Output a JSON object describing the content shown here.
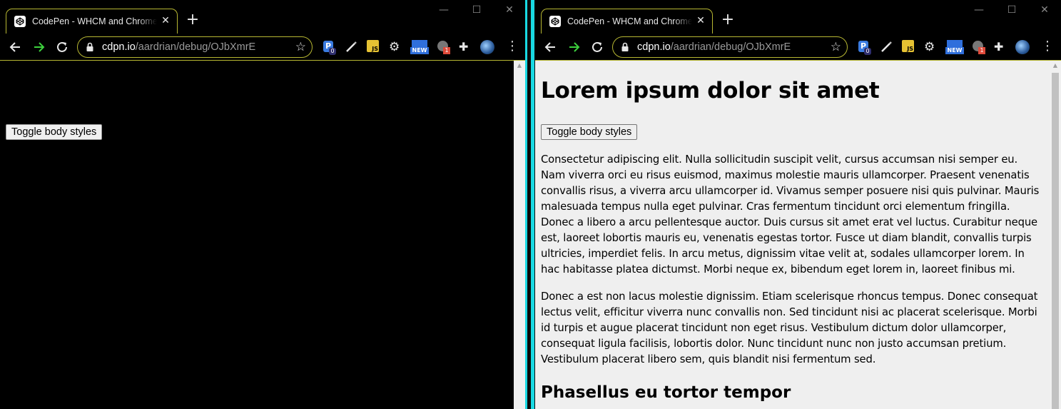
{
  "browser": {
    "tab_title": "CodePen - WHCM and Chrome Extension",
    "url_host": "cdpn.io",
    "url_path": "/aardrian/debug/OJbXmrE",
    "new_tab_label": "+",
    "tab_close": "✕",
    "window_controls": {
      "minimize": "—",
      "maximize": "☐",
      "close": "✕"
    },
    "extensions": [
      {
        "name": "p-extension-icon",
        "badge": "0"
      },
      {
        "name": "pen-extension-icon",
        "badge": ""
      },
      {
        "name": "js-extension-icon",
        "badge": ""
      },
      {
        "name": "gear-extension-icon",
        "badge": ""
      },
      {
        "name": "new-extension-icon",
        "badge": "NEW"
      },
      {
        "name": "grey-extension-icon",
        "badge": "1"
      },
      {
        "name": "puzzle-extension-icon",
        "badge": ""
      },
      {
        "name": "globe-profile-icon",
        "badge": ""
      }
    ]
  },
  "page": {
    "heading": "Lorem ipsum dolor sit amet",
    "toggle_button": "Toggle body styles",
    "paragraphs": [
      "Consectetur adipiscing elit. Nulla sollicitudin suscipit velit, cursus accumsan nisi semper eu. Nam viverra orci eu risus euismod, maximus molestie mauris ullamcorper. Praesent venenatis convallis risus, a viverra arcu ullamcorper id. Vivamus semper posuere nisi quis pulvinar. Mauris malesuada tempus nulla eget pulvinar. Cras fermentum tincidunt orci elementum fringilla. Donec a libero a arcu pellentesque auctor. Duis cursus sit amet erat vel luctus. Curabitur neque est, laoreet lobortis mauris eu, venenatis egestas tortor. Fusce ut diam blandit, convallis turpis ultricies, imperdiet felis. In arcu metus, dignissim vitae velit at, sodales ullamcorper lorem. In hac habitasse platea dictumst. Morbi neque ex, bibendum eget lorem in, laoreet finibus mi.",
      "Donec a est non lacus molestie dignissim. Etiam scelerisque rhoncus tempus. Donec consequat lectus velit, efficitur viverra nunc convallis non. Sed tincidunt nisi ac placerat scelerisque. Morbi id turpis et augue placerat tincidunt non eget risus. Vestibulum dictum dolor ullamcorper, consequat ligula facilisis, lobortis dolor. Nunc tincidunt nunc non justo accumsan pretium. Vestibulum placerat libero sem, quis blandit nisi fermentum sed."
    ],
    "subheading": "Phasellus eu tortor tempor"
  },
  "colors": {
    "focus_outline": "#b7b732",
    "separator": "#19d9e3",
    "dark_bg": "#000000",
    "light_bg": "#efefef"
  }
}
